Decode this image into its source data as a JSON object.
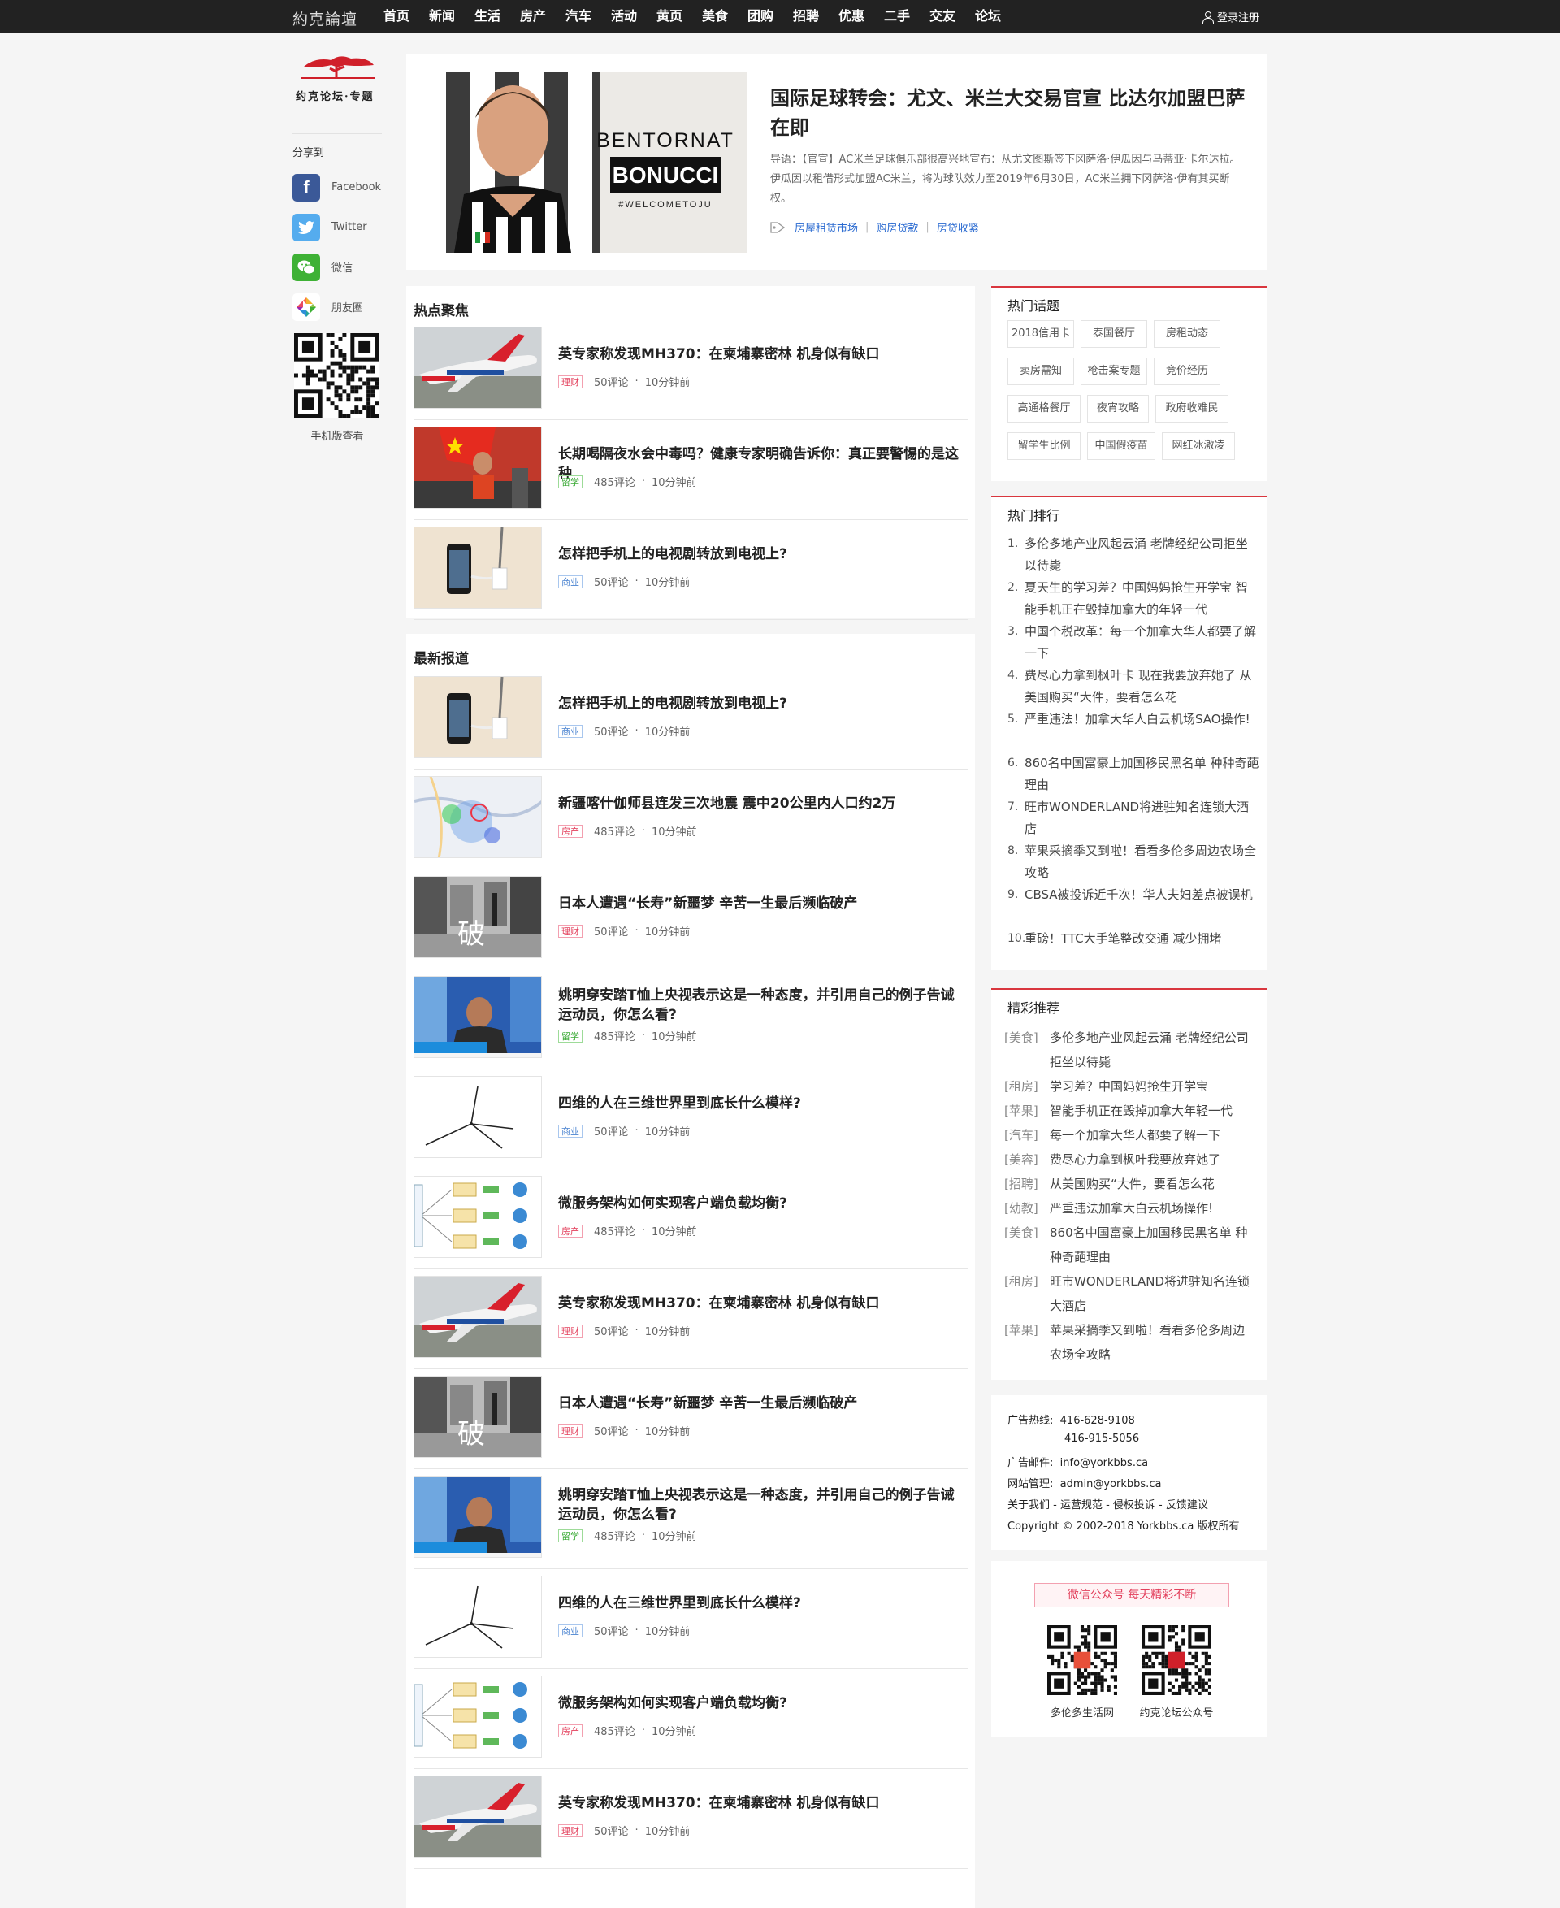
{
  "nav": {
    "logo": "約克論壇",
    "items": [
      "首页",
      "新闻",
      "生活",
      "房产",
      "汽车",
      "活动",
      "黄页",
      "美食",
      "团购",
      "招聘",
      "优惠",
      "二手",
      "交友",
      "论坛"
    ],
    "login": "登录注册"
  },
  "left": {
    "brand_text": "约克论坛·专题",
    "share_title": "分享到",
    "share": [
      {
        "label": "Facebook",
        "icon": "facebook-icon",
        "color": "#3b5998"
      },
      {
        "label": "Twitter",
        "icon": "twitter-icon",
        "color": "#55acee"
      },
      {
        "label": "微信",
        "icon": "wechat-icon",
        "color": "#3eb135"
      },
      {
        "label": "朋友圈",
        "icon": "moments-icon",
        "color": "#f2b22c"
      }
    ],
    "qr_caption": "手机版查看"
  },
  "hero": {
    "title": "国际足球转会：尤文、米兰大交易官宣 比达尔加盟巴萨在即",
    "desc": "导语：【官宣】AC米兰足球俱乐部很高兴地宣布：从尤文图斯签下冈萨洛·伊瓜因与马蒂亚·卡尔达拉。伊瓜因以租借形式加盟AC米兰，将为球队效力至2019年6月30日，AC米兰拥下冈萨洛·伊有其买断权。",
    "image_text": [
      "BENTORNAT",
      "BONUCCI",
      "#WELCOMETOJU"
    ],
    "tags": [
      "房屋租赁市场",
      "购房贷款",
      "房贷收紧"
    ]
  },
  "hot": {
    "title": "热点聚焦",
    "items": [
      {
        "title": "英专家称发现MH370：在柬埔寨密林 机身似有缺口",
        "badge": "理财",
        "comments": "50评论",
        "time": "10分钟前",
        "thumb": "plane"
      },
      {
        "title": "长期喝隔夜水会中毒吗？健康专家明确告诉你：真正要警惕的是这种",
        "badge": "留学",
        "comments": "485评论",
        "time": "10分钟前",
        "thumb": "runner"
      },
      {
        "title": "怎样把手机上的电视剧转放到电视上?",
        "badge": "商业",
        "comments": "50评论",
        "time": "10分钟前",
        "thumb": "phone"
      }
    ]
  },
  "latest": {
    "title": "最新报道",
    "items": [
      {
        "title": "怎样把手机上的电视剧转放到电视上?",
        "badge": "商业",
        "comments": "50评论",
        "time": "10分钟前",
        "thumb": "phone"
      },
      {
        "title": "新疆喀什伽师县连发三次地震 震中20公里内人口约2万",
        "badge": "房产",
        "comments": "485评论",
        "time": "10分钟前",
        "thumb": "map"
      },
      {
        "title": "日本人遭遇“长寿”新噩梦 辛苦一生最后濒临破产",
        "badge": "理财",
        "comments": "50评论",
        "time": "10分钟前",
        "thumb": "street"
      },
      {
        "title": "姚明穿安踏T恤上央视表示这是一种态度，并引用自己的例子告诫运动员，你怎么看?",
        "badge": "留学",
        "comments": "485评论",
        "time": "10分钟前",
        "thumb": "tv"
      },
      {
        "title": "四维的人在三维世界里到底长什么模样?",
        "badge": "商业",
        "comments": "50评论",
        "time": "10分钟前",
        "thumb": "lines"
      },
      {
        "title": "微服务架构如何实现客户端负载均衡?",
        "badge": "房产",
        "comments": "485评论",
        "time": "10分钟前",
        "thumb": "arch"
      },
      {
        "title": "英专家称发现MH370：在柬埔寨密林 机身似有缺口",
        "badge": "理财",
        "comments": "50评论",
        "time": "10分钟前",
        "thumb": "plane"
      },
      {
        "title": "日本人遭遇“长寿”新噩梦 辛苦一生最后濒临破产",
        "badge": "理财",
        "comments": "50评论",
        "time": "10分钟前",
        "thumb": "street"
      },
      {
        "title": "姚明穿安踏T恤上央视表示这是一种态度，并引用自己的例子告诫运动员，你怎么看?",
        "badge": "留学",
        "comments": "485评论",
        "time": "10分钟前",
        "thumb": "tv"
      },
      {
        "title": "四维的人在三维世界里到底长什么模样?",
        "badge": "商业",
        "comments": "50评论",
        "time": "10分钟前",
        "thumb": "lines"
      },
      {
        "title": "微服务架构如何实现客户端负载均衡?",
        "badge": "房产",
        "comments": "485评论",
        "time": "10分钟前",
        "thumb": "arch"
      },
      {
        "title": "英专家称发现MH370：在柬埔寨密林 机身似有缺口",
        "badge": "理财",
        "comments": "50评论",
        "time": "10分钟前",
        "thumb": "plane"
      }
    ]
  },
  "topics": {
    "title": "热门话题",
    "items": [
      "2018信用卡",
      "泰国餐厅",
      "房租动态",
      "卖房需知",
      "枪击案专题",
      "竞价经历",
      "高通格餐厅",
      "夜宵攻略",
      "政府收难民",
      "留学生比例",
      "中国假疫苗",
      "网红冰激凌"
    ]
  },
  "ranking": {
    "title": "热门排行",
    "items": [
      {
        "num": "1.",
        "text": "多伦多地产业风起云涌 老牌经纪公司拒坐以待毙"
      },
      {
        "num": "2.",
        "text": "夏天生的学习差？中国妈妈抢生开学宝 智能手机正在毁掉加拿大的年轻一代"
      },
      {
        "num": "3.",
        "text": "中国个税改革：每一个加拿大华人都要了解一下"
      },
      {
        "num": "4.",
        "text": "费尽心力拿到枫叶卡 现在我要放弃她了 从美国购买“大件，要看怎么花"
      },
      {
        "num": "5.",
        "text": "严重违法！加拿大华人白云机场SAO操作!"
      },
      {
        "num": "6.",
        "text": "860名中国富豪上加国移民黑名单 种种奇葩理由"
      },
      {
        "num": "7.",
        "text": "旺市WONDERLAND将进驻知名连锁大酒店"
      },
      {
        "num": "8.",
        "text": "苹果采摘季又到啦！看看多伦多周边农场全攻略"
      },
      {
        "num": "9.",
        "text": "CBSA被投诉近千次！华人夫妇差点被误机"
      },
      {
        "num": "10.",
        "text": "重磅！TTC大手笔整改交通 减少拥堵"
      }
    ]
  },
  "recommend": {
    "title": "精彩推荐",
    "items": [
      {
        "cat": "[美食]",
        "text": "多伦多地产业风起云涌 老牌经纪公司拒坐以待毙"
      },
      {
        "cat": "[租房]",
        "text": "学习差？中国妈妈抢生开学宝"
      },
      {
        "cat": "[苹果]",
        "text": "智能手机正在毁掉加拿大年轻一代"
      },
      {
        "cat": "[汽车]",
        "text": "每一个加拿大华人都要了解一下"
      },
      {
        "cat": "[美容]",
        "text": "费尽心力拿到枫叶我要放弃她了"
      },
      {
        "cat": "[招聘]",
        "text": "从美国购买“大件，要看怎么花"
      },
      {
        "cat": "[幼教]",
        "text": "严重违法加拿大白云机场操作!"
      },
      {
        "cat": "[美食]",
        "text": "860名中国富豪上加国移民黑名单 种种奇葩理由"
      },
      {
        "cat": "[租房]",
        "text": "旺市WONDERLAND将进驻知名连锁大酒店"
      },
      {
        "cat": "[苹果]",
        "text": "苹果采摘季又到啦！看看多伦多周边农场全攻略"
      }
    ]
  },
  "footer": {
    "hotline_label": "广告热线:",
    "hotline1": "416-628-9108",
    "hotline2": "416-915-5056",
    "email_label": "广告邮件:",
    "email": "info@yorkbbs.ca",
    "admin_label": "网站管理:",
    "admin": "admin@yorkbbs.ca",
    "links": "关于我们 - 运营规范 - 侵权投诉 - 反馈建议",
    "copyright": "Copyright © 2002-2018 Yorkbbs.ca  版权所有"
  },
  "wechat": {
    "bar": "微信公众号  每天精彩不断",
    "qr1": "多伦多生活网",
    "qr2": "约克论坛公众号"
  }
}
